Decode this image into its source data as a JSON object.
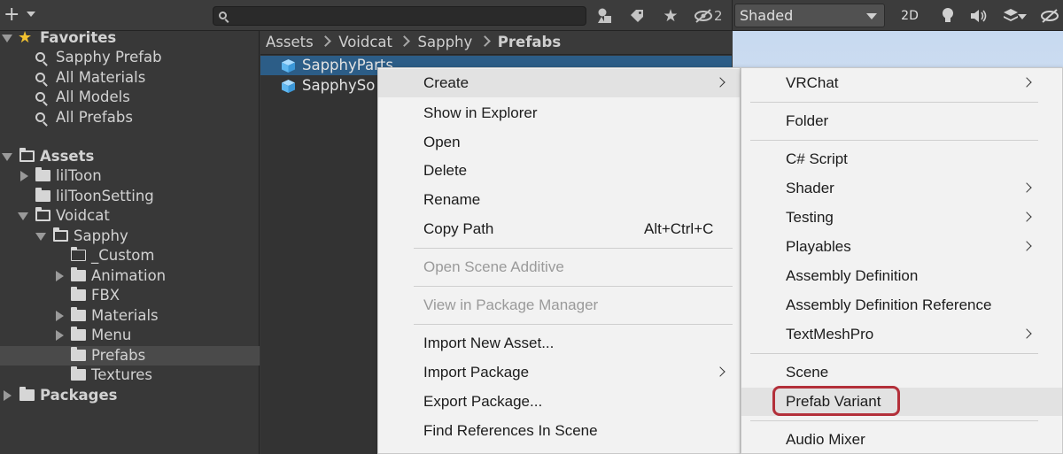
{
  "toolbar": {
    "add_icon": "plus-icon",
    "search_placeholder": "",
    "search_value": "",
    "hidden_count": "2"
  },
  "scene_toolbar": {
    "shading_mode": "Shaded",
    "mode_2d": "2D"
  },
  "tree": {
    "favorites_label": "Favorites",
    "favorites": [
      "Sapphy Prefab",
      "All Materials",
      "All Models",
      "All Prefabs"
    ],
    "assets_label": "Assets",
    "liltoon": "lilToon",
    "liltoon_setting": "lilToonSetting",
    "voidcat": "Voidcat",
    "sapphy": "Sapphy",
    "custom": "_Custom",
    "animation": "Animation",
    "fbx": "FBX",
    "materials": "Materials",
    "menu": "Menu",
    "prefabs": "Prefabs",
    "textures": "Textures",
    "packages_label": "Packages"
  },
  "breadcrumb": [
    "Assets",
    "Voidcat",
    "Sapphy",
    "Prefabs"
  ],
  "files": [
    "SapphyParts",
    "SapphySo"
  ],
  "context_menu": {
    "create": "Create",
    "show_in_explorer": "Show in Explorer",
    "open": "Open",
    "delete": "Delete",
    "rename": "Rename",
    "copy_path": "Copy Path",
    "copy_path_shortcut": "Alt+Ctrl+C",
    "open_scene_additive": "Open Scene Additive",
    "view_in_package_manager": "View in Package Manager",
    "import_new_asset": "Import New Asset...",
    "import_package": "Import Package",
    "export_package": "Export Package...",
    "find_references": "Find References In Scene"
  },
  "create_submenu": {
    "vrchat": "VRChat",
    "folder": "Folder",
    "csharp_script": "C# Script",
    "shader": "Shader",
    "testing": "Testing",
    "playables": "Playables",
    "assembly_definition": "Assembly Definition",
    "assembly_definition_reference": "Assembly Definition Reference",
    "textmeshpro": "TextMeshPro",
    "scene": "Scene",
    "prefab_variant": "Prefab Variant",
    "audio_mixer": "Audio Mixer"
  },
  "colors": {
    "highlight": "#b3303a",
    "selection": "#2c5d87",
    "favorite_star": "#f2c230"
  }
}
